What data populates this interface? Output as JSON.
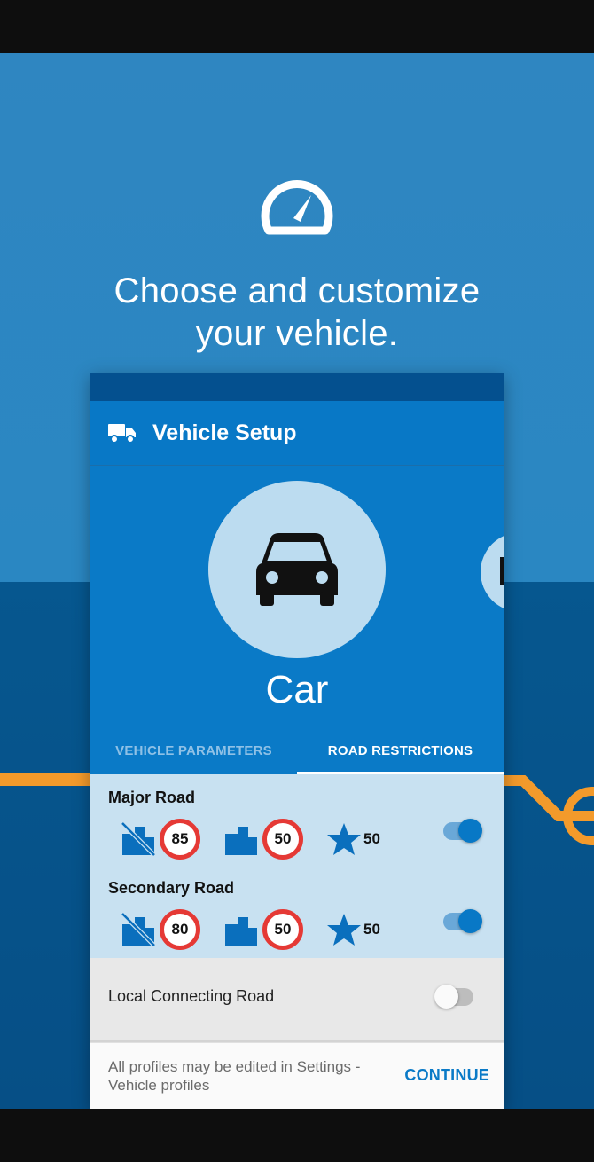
{
  "headline": {
    "line1": "Choose and customize",
    "line2": "your vehicle."
  },
  "hero_icon": "speedometer-icon",
  "app": {
    "title": "Vehicle Setup",
    "title_icon": "truck-icon"
  },
  "vehicle": {
    "selected": "Car",
    "selected_icon": "car-icon"
  },
  "tabs": [
    {
      "label": "VEHICLE PARAMETERS",
      "active": false
    },
    {
      "label": "ROAD RESTRICTIONS",
      "active": true
    }
  ],
  "roads": [
    {
      "label": "Major Road",
      "outside_town_limit": "85",
      "in_town_limit": "50",
      "favorite_limit": "50",
      "enabled": true
    },
    {
      "label": "Secondary Road",
      "outside_town_limit": "80",
      "in_town_limit": "50",
      "favorite_limit": "50",
      "enabled": true
    }
  ],
  "local_road": {
    "label": "Local Connecting Road",
    "enabled": false
  },
  "footer": {
    "note": "All profiles may be edited in Settings - Vehicle profiles",
    "continue_label": "CONTINUE"
  },
  "colors": {
    "primary": "#0878c6",
    "accent_route": "#f39a2b",
    "speed_sign_border": "#e53935"
  }
}
